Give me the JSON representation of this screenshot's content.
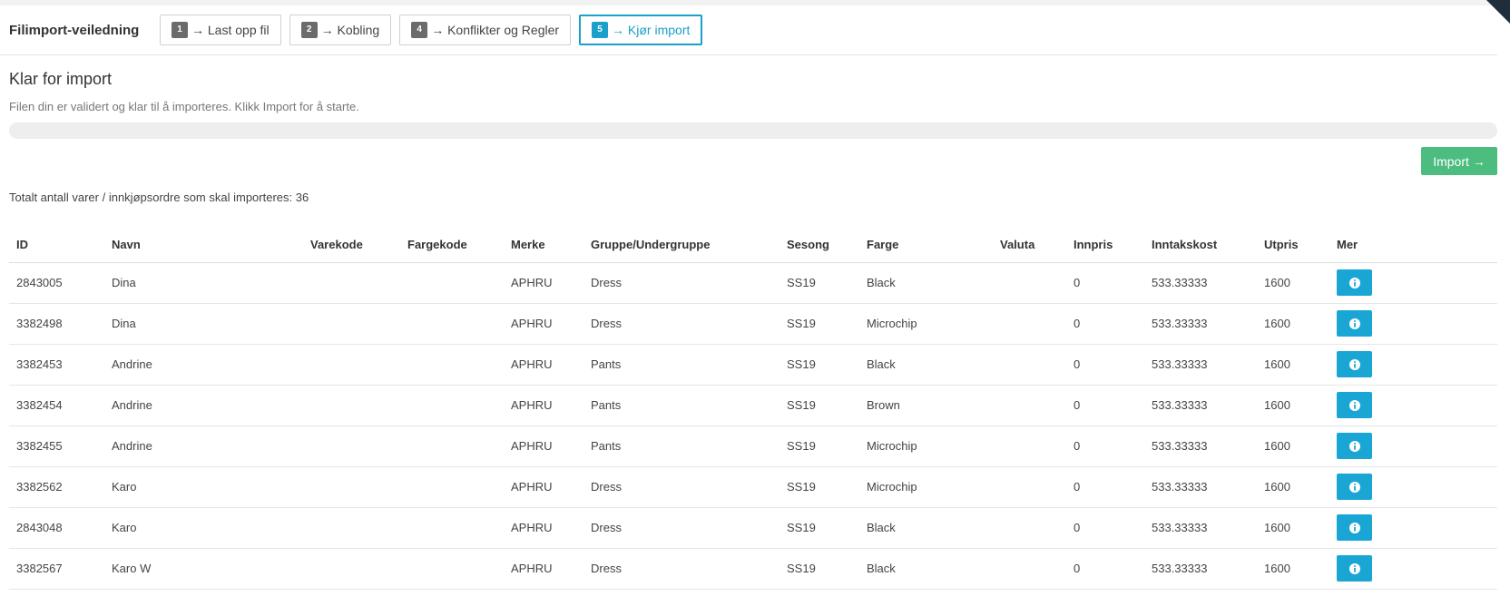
{
  "wizard": {
    "title": "Filimport-veiledning",
    "steps": [
      {
        "num": "1",
        "label": "→ Last opp fil"
      },
      {
        "num": "2",
        "label": "→ Kobling"
      },
      {
        "num": "4",
        "label": "→ Konflikter og Regler"
      },
      {
        "num": "5",
        "label": "→ Kjør import"
      }
    ]
  },
  "main": {
    "heading": "Klar for import",
    "subtext": "Filen din er validert og klar til å importeres. Klikk Import for å starte.",
    "import_label": "Import →",
    "total_text": "Totalt antall varer / innkjøpsordre som skal importeres: 36"
  },
  "progress": {
    "value_percent": 0
  },
  "colors": {
    "accent": "#1aa0c9",
    "import_button": "#4cbd7e",
    "info_button": "#1aa6d4"
  },
  "icons": {
    "info": "info-circle-icon"
  },
  "table": {
    "columns": [
      "ID",
      "Navn",
      "Varekode",
      "Fargekode",
      "Merke",
      "Gruppe/Undergruppe",
      "Sesong",
      "Farge",
      "Valuta",
      "Innpris",
      "Inntakskost",
      "Utpris",
      "Mer"
    ],
    "rows": [
      [
        "2843005",
        "Dina",
        "",
        "",
        "APHRU",
        "Dress",
        "SS19",
        "Black",
        "",
        "0",
        "533.33333",
        "1600"
      ],
      [
        "3382498",
        "Dina",
        "",
        "",
        "APHRU",
        "Dress",
        "SS19",
        "Microchip",
        "",
        "0",
        "533.33333",
        "1600"
      ],
      [
        "3382453",
        "Andrine",
        "",
        "",
        "APHRU",
        "Pants",
        "SS19",
        "Black",
        "",
        "0",
        "533.33333",
        "1600"
      ],
      [
        "3382454",
        "Andrine",
        "",
        "",
        "APHRU",
        "Pants",
        "SS19",
        "Brown",
        "",
        "0",
        "533.33333",
        "1600"
      ],
      [
        "3382455",
        "Andrine",
        "",
        "",
        "APHRU",
        "Pants",
        "SS19",
        "Microchip",
        "",
        "0",
        "533.33333",
        "1600"
      ],
      [
        "3382562",
        "Karo",
        "",
        "",
        "APHRU",
        "Dress",
        "SS19",
        "Microchip",
        "",
        "0",
        "533.33333",
        "1600"
      ],
      [
        "2843048",
        "Karo",
        "",
        "",
        "APHRU",
        "Dress",
        "SS19",
        "Black",
        "",
        "0",
        "533.33333",
        "1600"
      ],
      [
        "3382567",
        "Karo W",
        "",
        "",
        "APHRU",
        "Dress",
        "SS19",
        "Black",
        "",
        "0",
        "533.33333",
        "1600"
      ]
    ]
  }
}
